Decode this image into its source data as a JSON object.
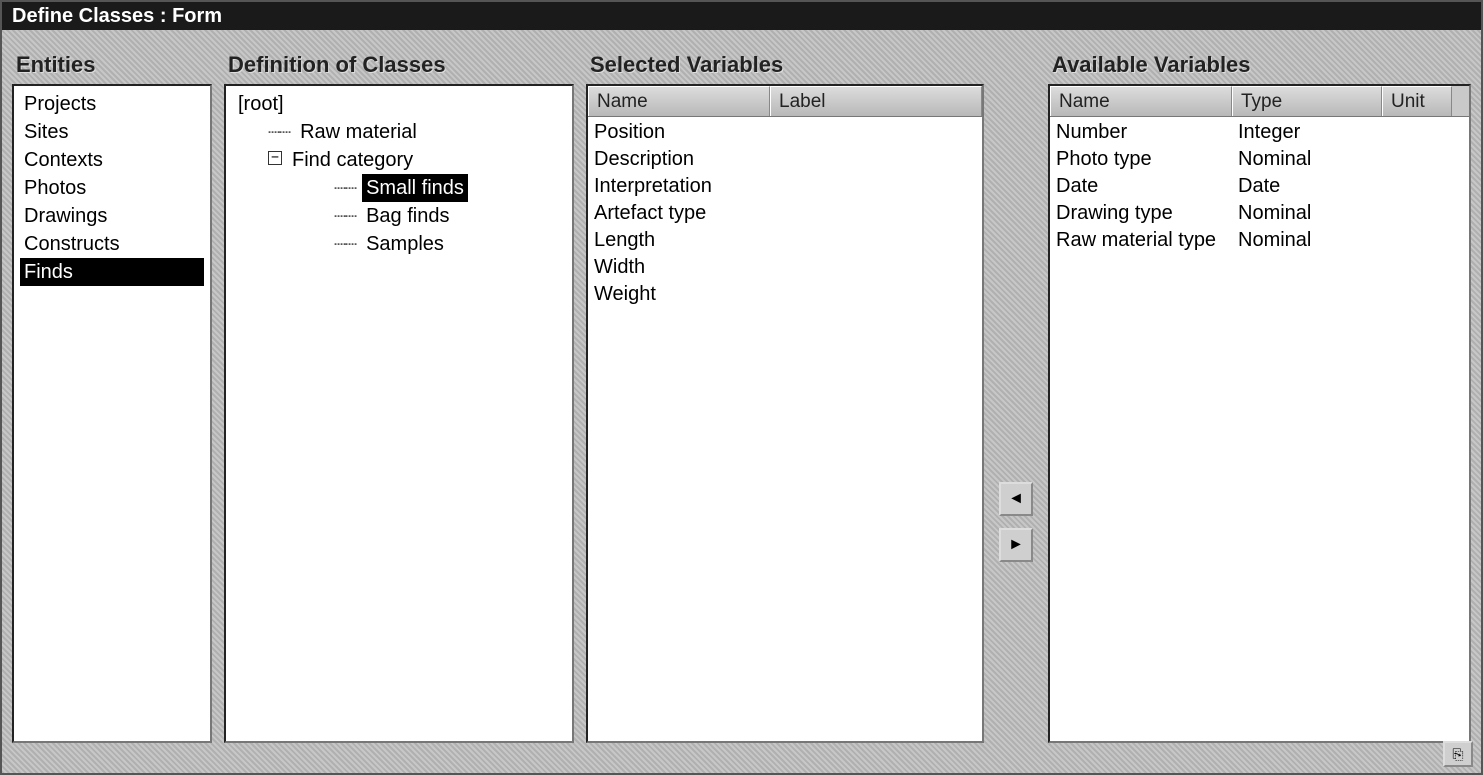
{
  "window": {
    "title": "Define Classes : Form"
  },
  "headings": {
    "entities": "Entities",
    "classes": "Definition of Classes",
    "selected": "Selected Variables",
    "available": "Available Variables"
  },
  "entities": {
    "items": [
      {
        "label": "Projects",
        "selected": false
      },
      {
        "label": "Sites",
        "selected": false
      },
      {
        "label": "Contexts",
        "selected": false
      },
      {
        "label": "Photos",
        "selected": false
      },
      {
        "label": "Drawings",
        "selected": false
      },
      {
        "label": "Constructs",
        "selected": false
      },
      {
        "label": "Finds",
        "selected": true
      }
    ]
  },
  "tree": {
    "root": "[root]",
    "nodes": [
      {
        "label": "Raw material",
        "depth": 1,
        "expander": ""
      },
      {
        "label": "Find category",
        "depth": 1,
        "expander": "−"
      },
      {
        "label": "Small finds",
        "depth": 2,
        "expander": "",
        "selected": true
      },
      {
        "label": "Bag finds",
        "depth": 2,
        "expander": ""
      },
      {
        "label": "Samples",
        "depth": 2,
        "expander": ""
      }
    ]
  },
  "selected_vars": {
    "columns": {
      "name": "Name",
      "label": "Label"
    },
    "rows": [
      {
        "name": "Position",
        "label": ""
      },
      {
        "name": "Description",
        "label": ""
      },
      {
        "name": "Interpretation",
        "label": ""
      },
      {
        "name": "Artefact type",
        "label": ""
      },
      {
        "name": "Length",
        "label": ""
      },
      {
        "name": "Width",
        "label": ""
      },
      {
        "name": "Weight",
        "label": ""
      }
    ]
  },
  "available_vars": {
    "columns": {
      "name": "Name",
      "type": "Type",
      "unit": "Unit"
    },
    "rows": [
      {
        "name": "Number",
        "type": "Integer",
        "unit": ""
      },
      {
        "name": "Photo type",
        "type": "Nominal",
        "unit": ""
      },
      {
        "name": "Date",
        "type": "Date",
        "unit": ""
      },
      {
        "name": "Drawing type",
        "type": "Nominal",
        "unit": ""
      },
      {
        "name": "Raw material type",
        "type": "Nominal",
        "unit": ""
      }
    ]
  },
  "arrows": {
    "left": "◄",
    "right": "►"
  },
  "corner_icon": "⎘"
}
